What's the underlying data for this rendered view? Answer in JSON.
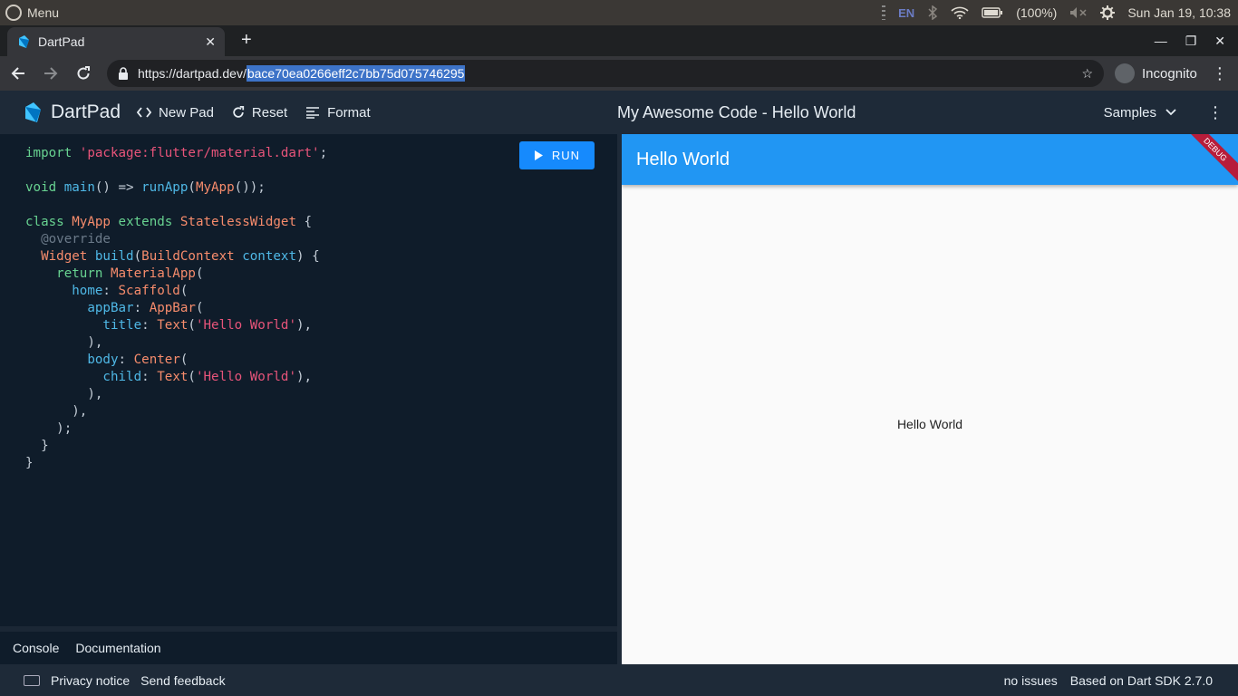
{
  "os": {
    "menu_label": "Menu",
    "lang": "EN",
    "battery": "(100%)",
    "datetime": "Sun Jan 19, 10:38"
  },
  "browser": {
    "tab_title": "DartPad",
    "url_base": "https://dartpad.dev/",
    "url_selected": "bace70ea0266eff2c7bb75d075746295",
    "incognito_label": "Incognito"
  },
  "header": {
    "brand": "DartPad",
    "new_pad": "New Pad",
    "reset": "Reset",
    "format": "Format",
    "title": "My Awesome Code - Hello World",
    "samples": "Samples"
  },
  "editor": {
    "run_label": "RUN",
    "lines": [
      "import 'package:flutter/material.dart';",
      "",
      "void main() => runApp(MyApp());",
      "",
      "class MyApp extends StatelessWidget {",
      "  @override",
      "  Widget build(BuildContext context) {",
      "    return MaterialApp(",
      "      home: Scaffold(",
      "        appBar: AppBar(",
      "          title: Text('Hello World'),",
      "        ),",
      "        body: Center(",
      "          child: Text('Hello World'),",
      "        ),",
      "      ),",
      "    );",
      "  }",
      "}"
    ]
  },
  "bottom_tabs": {
    "console": "Console",
    "documentation": "Documentation"
  },
  "preview": {
    "appbar_title": "Hello World",
    "debug_banner": "DEBUG",
    "body_text": "Hello World"
  },
  "status": {
    "privacy": "Privacy notice",
    "feedback": "Send feedback",
    "issues": "no issues",
    "sdk": "Based on Dart SDK 2.7.0"
  }
}
